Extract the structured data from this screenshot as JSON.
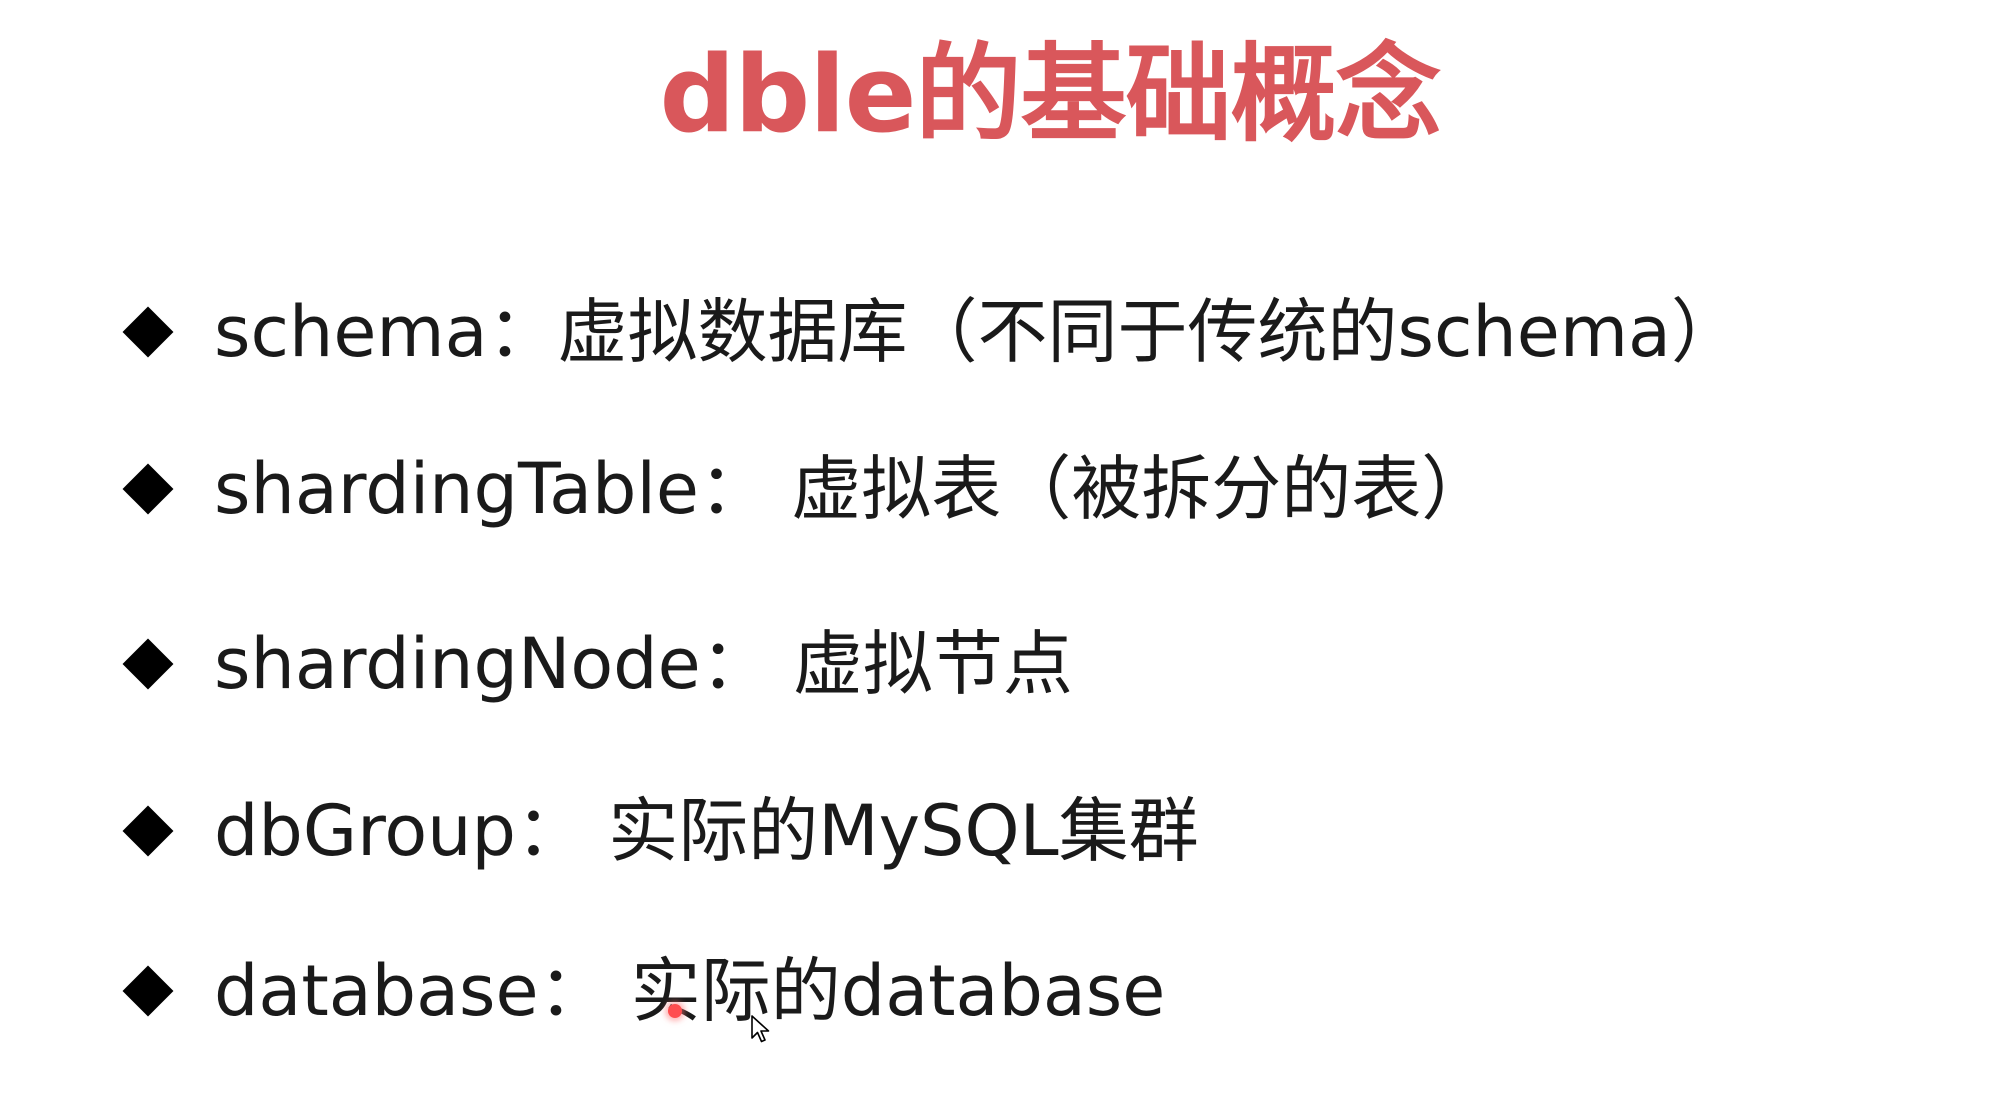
{
  "slide": {
    "title": "dble的基础概念",
    "title_color": "#d9575b",
    "bullets": [
      {
        "icon": "diamond-bullet-icon",
        "text": "schema：虚拟数据库（不同于传统的schema）"
      },
      {
        "icon": "diamond-bullet-icon",
        "text": "shardingTable： 虚拟表（被拆分的表）"
      },
      {
        "icon": "diamond-bullet-icon",
        "text": "shardingNode： 虚拟节点"
      },
      {
        "icon": "diamond-bullet-icon",
        "text": "dbGroup： 实际的MySQL集群"
      },
      {
        "icon": "diamond-bullet-icon",
        "text": "database： 实际的database"
      }
    ]
  },
  "overlay": {
    "cursor_icon": "mouse-pointer-icon",
    "click_indicator_icon": "click-highlight-icon",
    "click_indicator_color": "#ff4d4f"
  }
}
